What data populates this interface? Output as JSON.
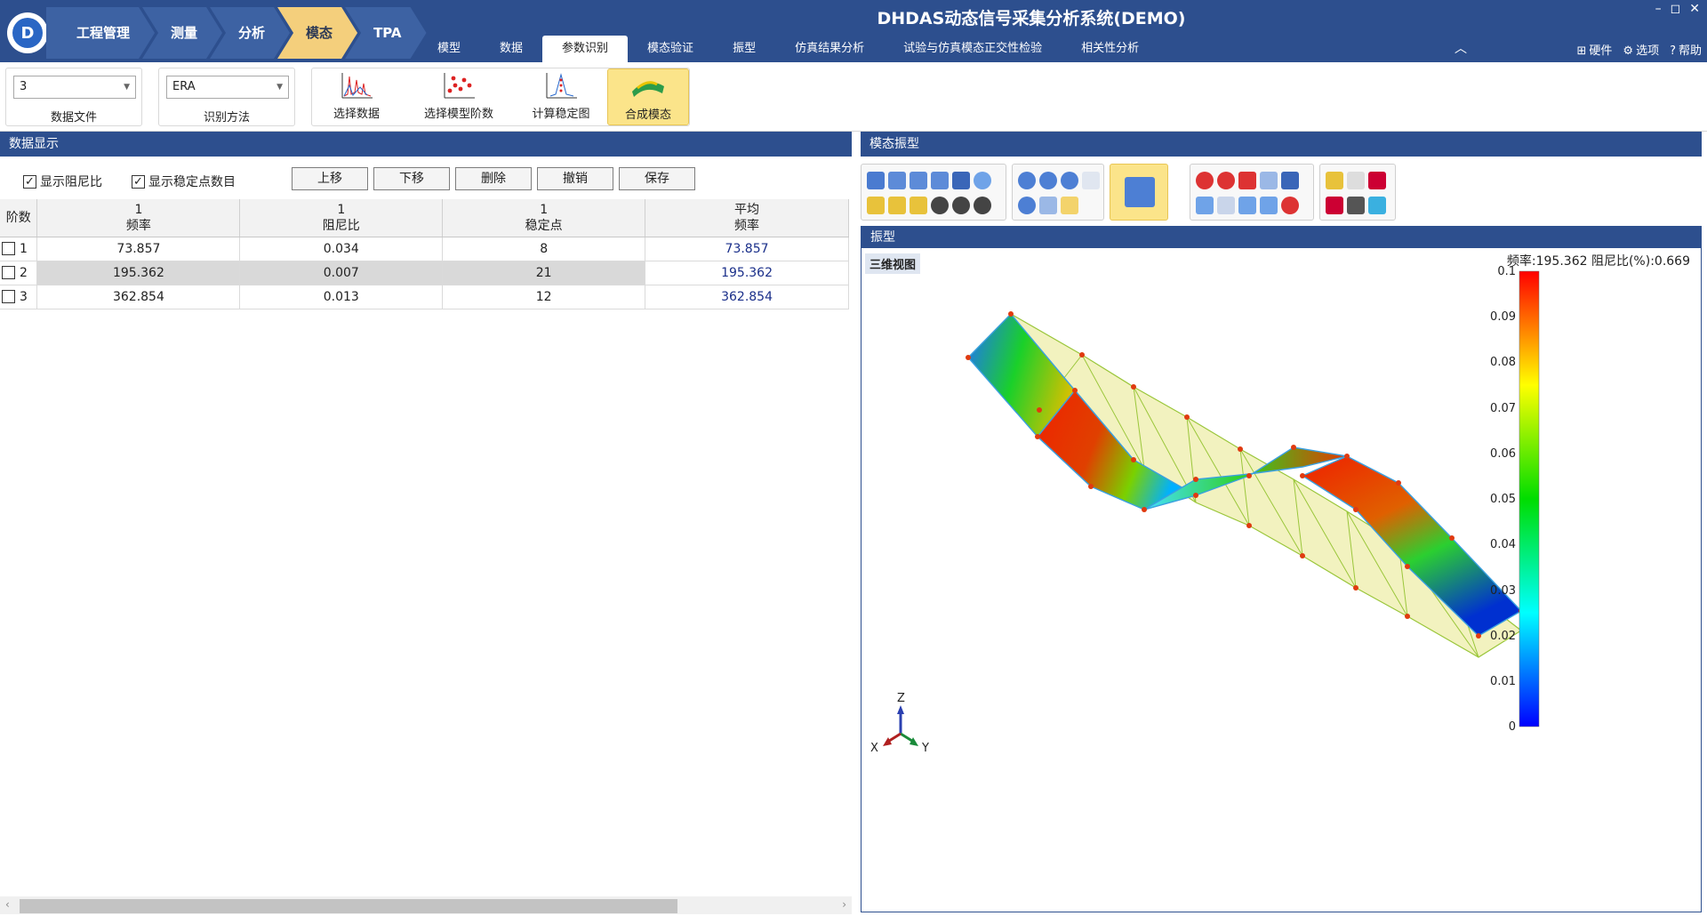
{
  "app_title": "DHDAS动态信号采集分析系统(DEMO)",
  "window_buttons": [
    "–",
    "◻",
    "✕"
  ],
  "breadcrumbs": [
    "工程管理",
    "测量",
    "分析",
    "模态",
    "TPA"
  ],
  "menu_tabs": [
    "模型",
    "数据",
    "参数识别",
    "模态验证",
    "振型",
    "仿真结果分析",
    "试验与仿真模态正交性检验",
    "相关性分析"
  ],
  "right_tools": {
    "hardware": "硬件",
    "options": "选项",
    "help": "帮助"
  },
  "ribbon": {
    "data_file": {
      "value": "3",
      "label": "数据文件"
    },
    "method": {
      "value": "ERA",
      "label": "识别方法"
    },
    "buttons": [
      "选择数据",
      "选择模型阶数",
      "计算稳定图",
      "合成模态"
    ]
  },
  "left": {
    "header": "数据显示",
    "check_damping": "显示阻尼比",
    "check_stable": "显示稳定点数目",
    "buttons": [
      "上移",
      "下移",
      "删除",
      "撤销",
      "保存"
    ],
    "columns": [
      {
        "top": "",
        "bottom": "阶数"
      },
      {
        "top": "1",
        "bottom": "频率"
      },
      {
        "top": "1",
        "bottom": "阻尼比"
      },
      {
        "top": "1",
        "bottom": "稳定点"
      },
      {
        "top": "平均",
        "bottom": "频率"
      }
    ],
    "rows": [
      {
        "idx": "1",
        "freq": "73.857",
        "damp": "0.034",
        "stable": "8",
        "avg": "73.857"
      },
      {
        "idx": "2",
        "freq": "195.362",
        "damp": "0.007",
        "stable": "21",
        "avg": "195.362"
      },
      {
        "idx": "3",
        "freq": "362.854",
        "damp": "0.013",
        "stable": "12",
        "avg": "362.854"
      }
    ]
  },
  "right": {
    "header": "模态振型",
    "view_header": "振型",
    "view_tag": "三维视图",
    "freq_text": "频率:195.362 阻尼比(%):0.669",
    "colorbar_labels": [
      "0.1",
      "0.09",
      "0.08",
      "0.07",
      "0.06",
      "0.05",
      "0.04",
      "0.03",
      "0.02",
      "0.01",
      "0"
    ],
    "axes": {
      "z": "Z",
      "x": "X",
      "y": "Y"
    },
    "colors": {
      "title_bar": "#2d4f8e",
      "active_crumb": "#f4cf7c",
      "active_button": "#fbe48a"
    }
  }
}
